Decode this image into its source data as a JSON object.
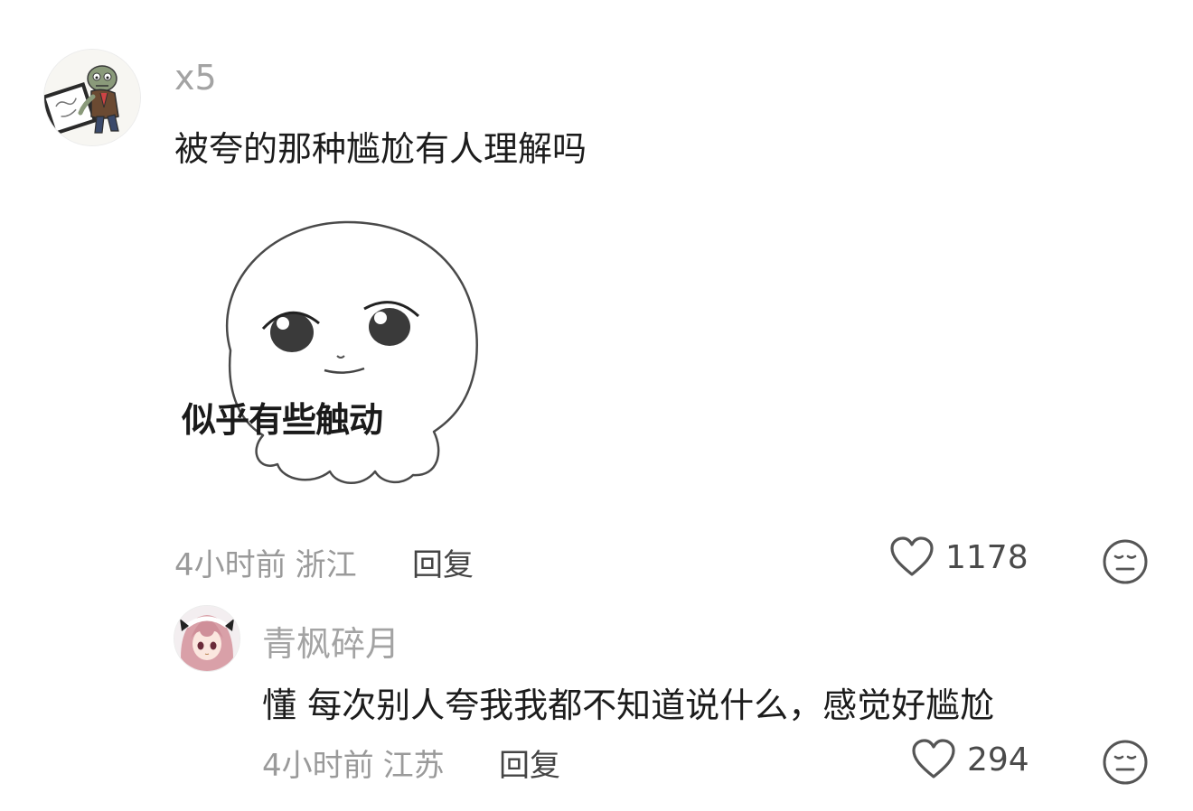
{
  "comments": [
    {
      "username": "x5",
      "text": "被夸的那种尴尬有人理解吗",
      "sticker_caption": "似乎有些触动",
      "time": "4小时前",
      "location": "浙江",
      "reply_label": "回复",
      "likes": "1178",
      "avatar_icon": "zombie-drawing-icon"
    },
    {
      "username": "青枫碎月",
      "text": "懂 每次别人夸我我都不知道说什么，感觉好尴尬",
      "time": "4小时前",
      "location": "江苏",
      "reply_label": "回复",
      "likes": "294",
      "avatar_icon": "anime-girl-avatar-icon"
    }
  ],
  "icons": {
    "like": "heart-outline-icon",
    "dislike": "meh-face-icon"
  },
  "colors": {
    "background": "#ffffff",
    "username": "#a3a3a3",
    "text": "#1c1c1c",
    "meta": "#9a9a9a",
    "icon": "#555555"
  }
}
